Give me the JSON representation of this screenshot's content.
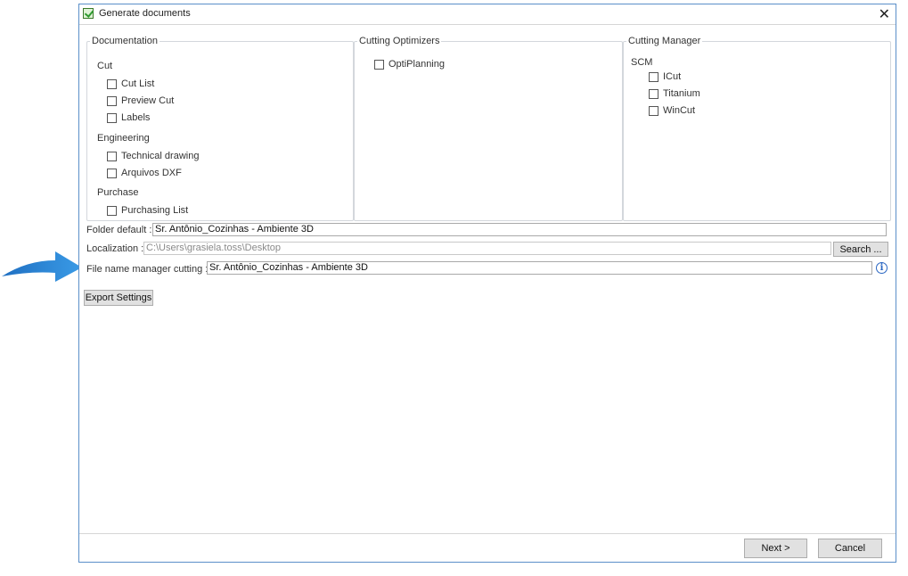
{
  "window": {
    "title": "Generate documents"
  },
  "documentation": {
    "legend": "Documentation",
    "cut": {
      "label": "Cut",
      "items": [
        "Cut List",
        "Preview Cut",
        "Labels"
      ]
    },
    "engineering": {
      "label": "Engineering",
      "items": [
        "Technical drawing",
        "Arquivos DXF"
      ]
    },
    "purchase": {
      "label": "Purchase",
      "items": [
        "Purchasing List"
      ]
    }
  },
  "optimizers": {
    "legend": "Cutting Optimizers",
    "items": [
      "OptiPlanning"
    ]
  },
  "manager": {
    "legend": "Cutting Manager",
    "scm_label": "SCM",
    "items": [
      "ICut",
      "Titanium",
      "WinCut"
    ]
  },
  "fields": {
    "folder_label": "Folder default :",
    "folder_value": "Sr. Antônio_Cozinhas - Ambiente 3D",
    "localization_label": "Localization :",
    "localization_value": "C:\\Users\\grasiela.toss\\Desktop",
    "search_button": "Search ...",
    "filename_label": "File name manager cutting :",
    "filename_value": "Sr. Antônio_Cozinhas - Ambiente 3D",
    "info_glyph": "i"
  },
  "buttons": {
    "export": "Export Settings",
    "next": "Next >",
    "cancel": "Cancel"
  },
  "annotation": {
    "arrow_color": "#2a85d6"
  }
}
